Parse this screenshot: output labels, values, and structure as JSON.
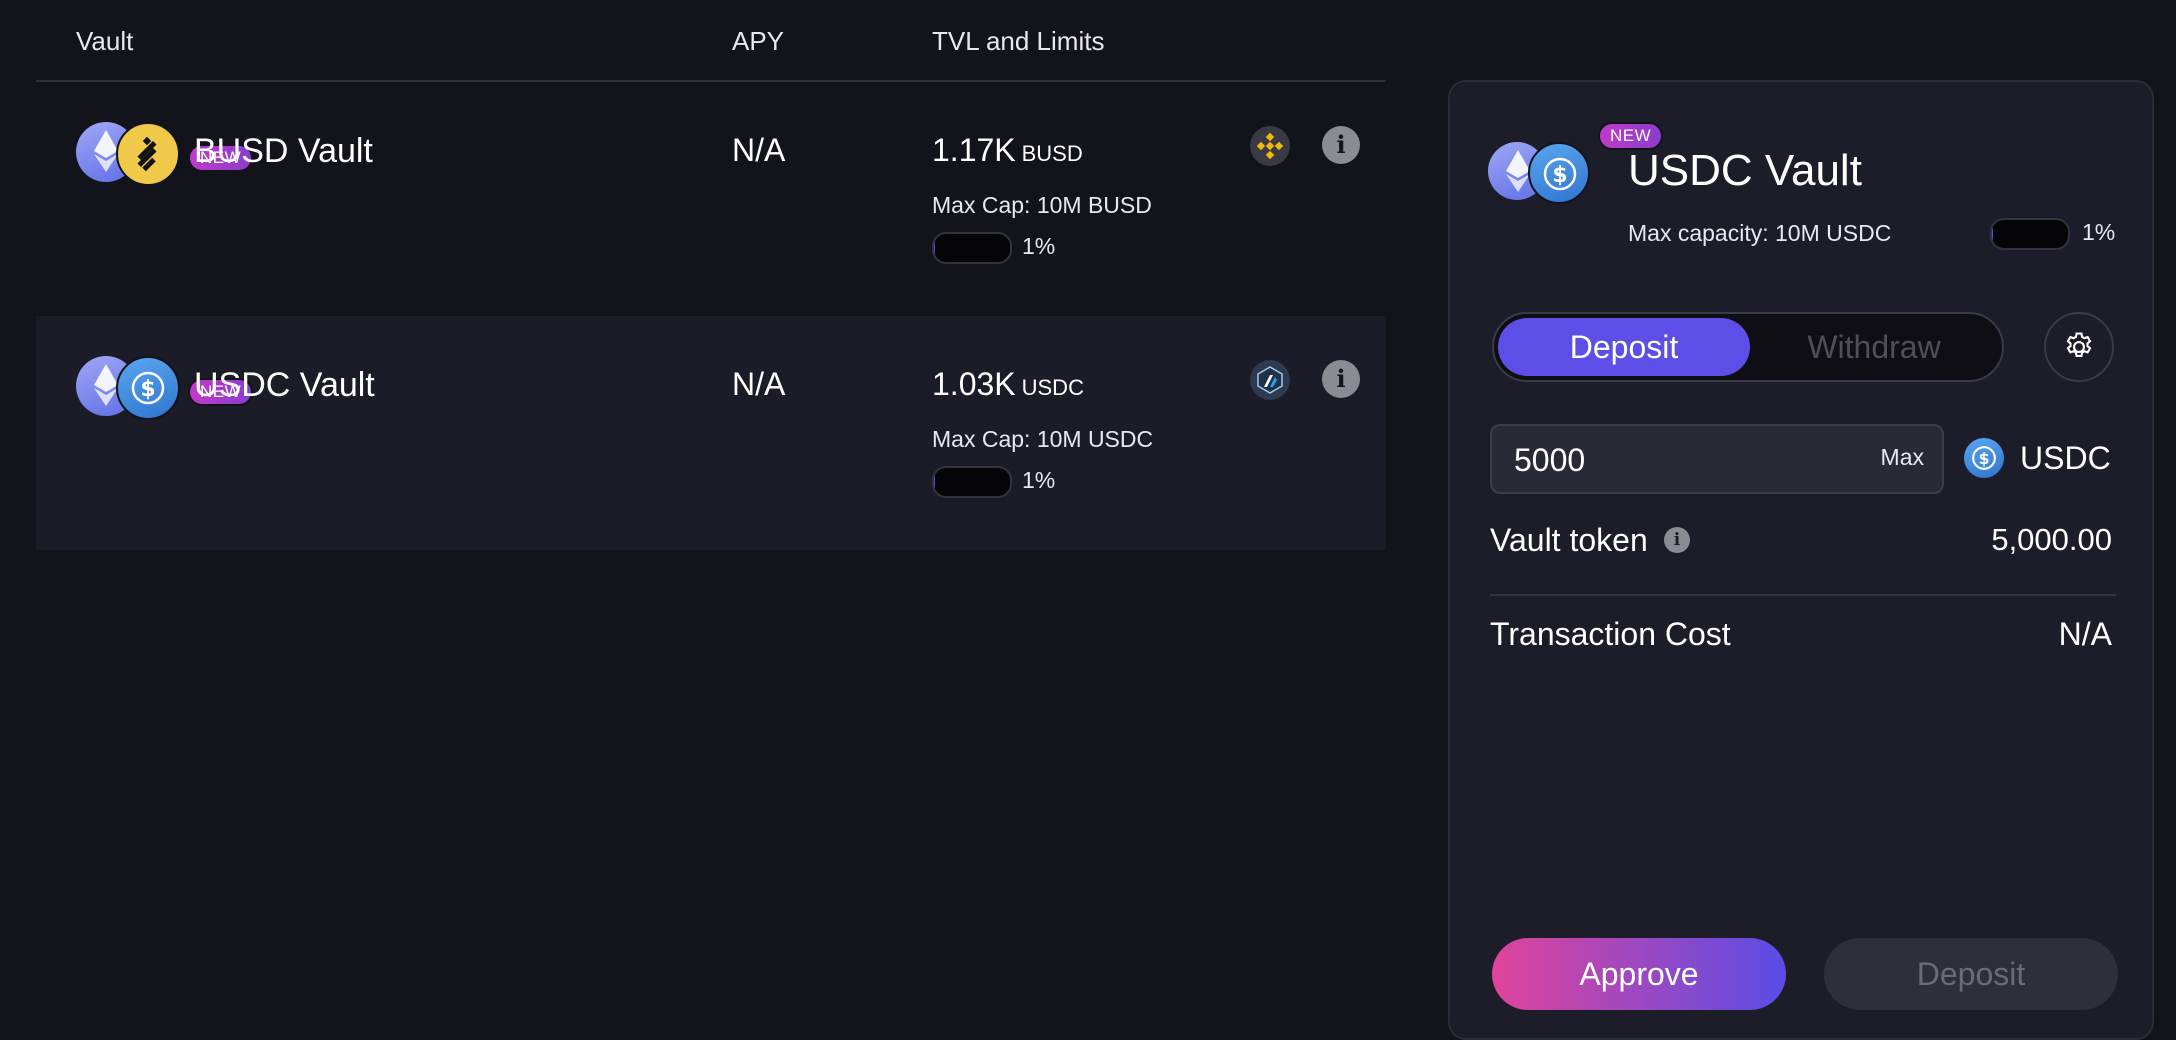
{
  "table": {
    "headers": {
      "vault": "Vault",
      "apy": "APY",
      "tvl": "TVL and Limits"
    },
    "rows": [
      {
        "name": "BUSD Vault",
        "badge": "NEW",
        "tokens": [
          "eth-icon",
          "busd-icon"
        ],
        "apy": "N/A",
        "tvl_value": "1.17K",
        "tvl_unit": "BUSD",
        "max_cap": "Max Cap: 10M BUSD",
        "progress_percent": 1,
        "progress_label": "1%",
        "network_icon": "bnb-chain-icon",
        "accent_color": "#f1c94a"
      },
      {
        "name": "USDC Vault",
        "badge": "NEW",
        "tokens": [
          "eth-icon",
          "usdc-icon"
        ],
        "apy": "N/A",
        "tvl_value": "1.03K",
        "tvl_unit": "USDC",
        "max_cap": "Max Cap: 10M USDC",
        "progress_percent": 1,
        "progress_label": "1%",
        "network_icon": "arbitrum-icon",
        "accent_color": "#2f74d0"
      }
    ]
  },
  "panel": {
    "title": "USDC Vault",
    "badge": "NEW",
    "max_capacity": "Max capacity: 10M USDC",
    "progress_percent": 1,
    "progress_label": "1%",
    "tabs": {
      "deposit": "Deposit",
      "withdraw": "Withdraw",
      "active": "deposit"
    },
    "amount": {
      "value": "5000",
      "max_label": "Max",
      "token": "USDC"
    },
    "vault_token": {
      "label": "Vault token",
      "value": "5,000.00"
    },
    "transaction_cost": {
      "label": "Transaction Cost",
      "value": "N/A"
    },
    "buttons": {
      "approve": "Approve",
      "deposit": "Deposit"
    }
  },
  "colors": {
    "background": "#13131b",
    "panel": "#1d1d29",
    "accent": "#5d4ee8",
    "approve_gradient_start": "#e0449b",
    "badge": "#c03bc9"
  }
}
